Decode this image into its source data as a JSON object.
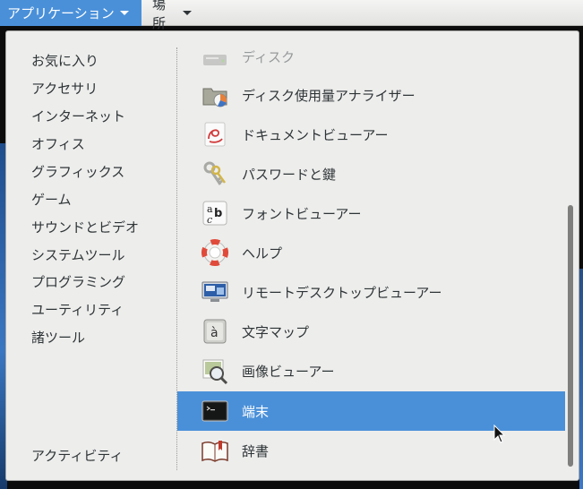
{
  "topbar": {
    "applications_label": "アプリケーション",
    "places_label": "場所"
  },
  "categories": [
    "お気に入り",
    "アクセサリ",
    "インターネット",
    "オフィス",
    "グラフィックス",
    "ゲーム",
    "サウンドとビデオ",
    "システムツール",
    "プログラミング",
    "ユーティリティ",
    "諸ツール"
  ],
  "activities_label": "アクティビティ",
  "apps": [
    {
      "label": "ディスク",
      "icon": "disks-icon"
    },
    {
      "label": "ディスク使用量アナライザー",
      "icon": "disk-usage-analyzer-icon"
    },
    {
      "label": "ドキュメントビューアー",
      "icon": "document-viewer-icon"
    },
    {
      "label": "パスワードと鍵",
      "icon": "passwords-keys-icon"
    },
    {
      "label": "フォントビューアー",
      "icon": "font-viewer-icon"
    },
    {
      "label": "ヘルプ",
      "icon": "help-lifebuoy-icon"
    },
    {
      "label": "リモートデスクトップビューアー",
      "icon": "remote-desktop-icon"
    },
    {
      "label": "文字マップ",
      "icon": "character-map-icon"
    },
    {
      "label": "画像ビューアー",
      "icon": "image-viewer-icon"
    },
    {
      "label": "端末",
      "icon": "terminal-icon"
    },
    {
      "label": "辞書",
      "icon": "dictionary-icon"
    }
  ],
  "selected_app": "端末",
  "colors": {
    "selection": "#4a90d9",
    "menu_background": "#ededec",
    "text": "#2e3436"
  }
}
